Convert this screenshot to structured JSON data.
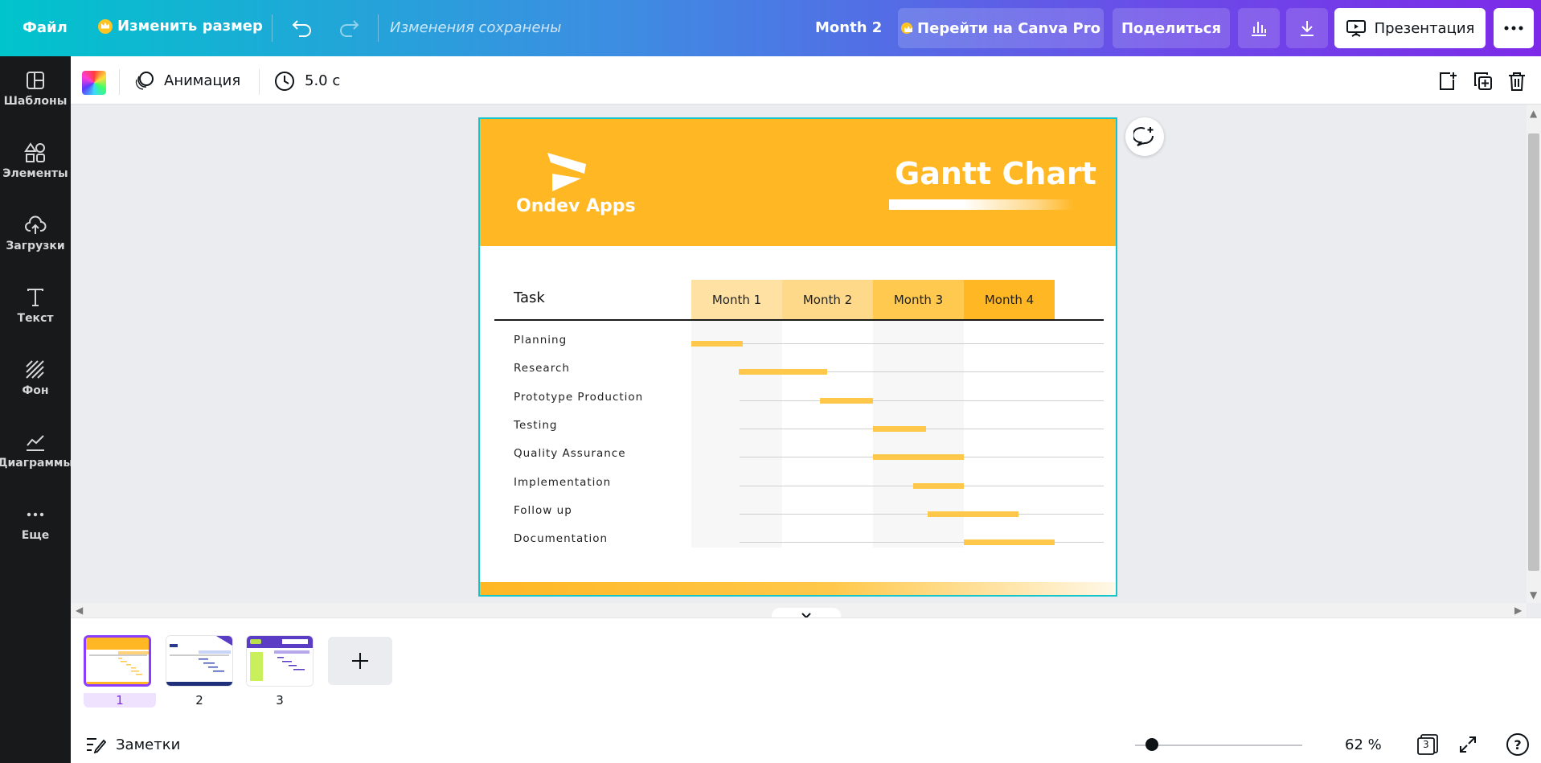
{
  "topbar": {
    "file_label": "Файл",
    "resize_label": "Изменить размер",
    "saved_status": "Изменения сохранены",
    "design_title": "Month 2",
    "pro_label": "Перейти на Canva Pro",
    "share_label": "Поделиться",
    "present_label": "Презентация",
    "icons": [
      "undo-icon",
      "redo-icon",
      "stats-icon",
      "download-icon",
      "present-icon",
      "more-icon"
    ]
  },
  "sidebar": {
    "items": [
      {
        "label": "Шаблоны",
        "icon": "templates-icon"
      },
      {
        "label": "Элементы",
        "icon": "elements-icon"
      },
      {
        "label": "Загрузки",
        "icon": "uploads-icon"
      },
      {
        "label": "Текст",
        "icon": "text-icon"
      },
      {
        "label": "Фон",
        "icon": "background-icon"
      },
      {
        "label": "Диаграммы",
        "icon": "charts-icon"
      },
      {
        "label": "Еще",
        "icon": "more-icon"
      }
    ]
  },
  "toolbar": {
    "animation_label": "Анимация",
    "duration_label": "5.0 с",
    "icons": [
      "color-picker-icon",
      "animation-icon",
      "clock-icon",
      "add-page-icon",
      "duplicate-page-icon",
      "trash-icon"
    ]
  },
  "slide": {
    "logo_text": "Ondev Apps",
    "title": "Gantt Chart",
    "task_header": "Task",
    "months": [
      "Month 1",
      "Month 2",
      "Month 3",
      "Month 4"
    ],
    "tasks": [
      {
        "name": "Planning",
        "start": 0,
        "end": 0.57
      },
      {
        "name": "Research",
        "start": 0.52,
        "end": 1.5
      },
      {
        "name": "Prototype Production",
        "start": 1.42,
        "end": 2.0
      },
      {
        "name": "Testing",
        "start": 2.0,
        "end": 2.58
      },
      {
        "name": "Quality Assurance",
        "start": 2.0,
        "end": 3.0
      },
      {
        "name": "Implementation",
        "start": 2.44,
        "end": 3.0
      },
      {
        "name": "Follow up",
        "start": 2.6,
        "end": 3.6
      },
      {
        "name": "Documentation",
        "start": 3.0,
        "end": 4.0
      }
    ],
    "colors": {
      "header": "#ffb724",
      "bar": "#ffc84a",
      "month1": "#ffe2a3",
      "month2": "#ffd98a",
      "month3": "#ffc94f",
      "month4": "#ffb724"
    }
  },
  "pages_panel": {
    "pages": [
      "1",
      "2",
      "3"
    ],
    "active_page": "1"
  },
  "bottombar": {
    "notes_label": "Заметки",
    "zoom_label": "62 %",
    "page_count": "3",
    "zoom_level": 0.62
  }
}
